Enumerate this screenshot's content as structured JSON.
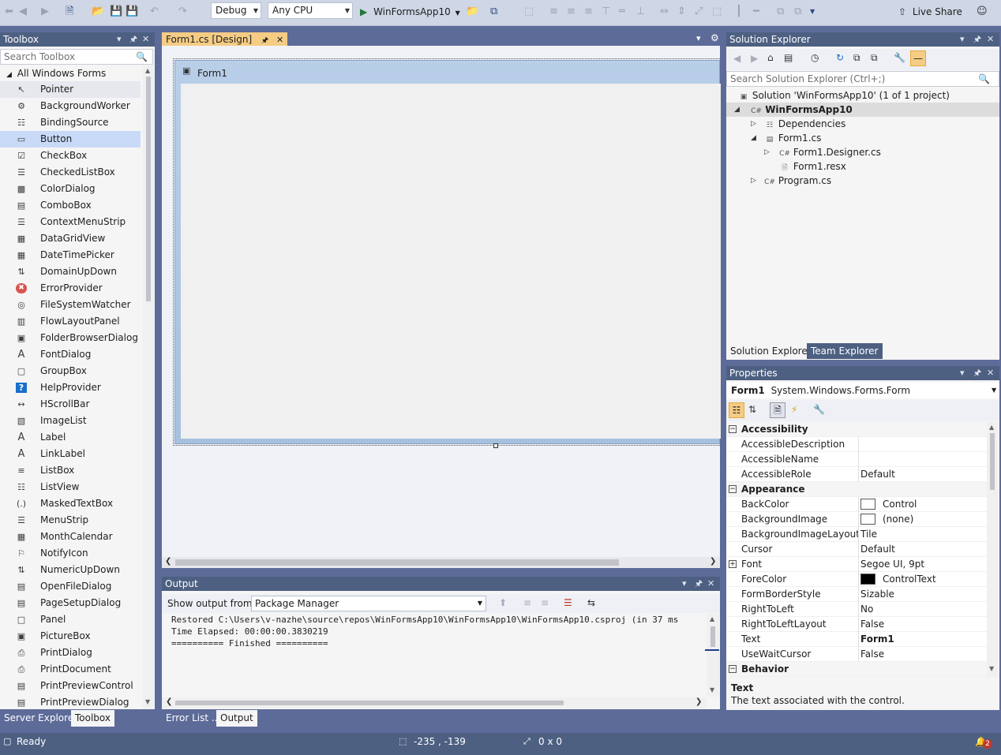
{
  "toolbar": {
    "config": "Debug",
    "platform": "Any CPU",
    "start_target": "WinFormsApp10",
    "live_share": "Live Share"
  },
  "toolbox": {
    "title": "Toolbox",
    "search_placeholder": "Search Toolbox",
    "group": "All Windows Forms",
    "items": [
      {
        "label": "Pointer",
        "icon": "pointer-icon"
      },
      {
        "label": "BackgroundWorker",
        "icon": "gear-icon"
      },
      {
        "label": "BindingSource",
        "icon": "binding-icon"
      },
      {
        "label": "Button",
        "icon": "button-icon"
      },
      {
        "label": "CheckBox",
        "icon": "checkbox-icon"
      },
      {
        "label": "CheckedListBox",
        "icon": "checklist-icon"
      },
      {
        "label": "ColorDialog",
        "icon": "color-icon"
      },
      {
        "label": "ComboBox",
        "icon": "combobox-icon"
      },
      {
        "label": "ContextMenuStrip",
        "icon": "menu-icon"
      },
      {
        "label": "DataGridView",
        "icon": "grid-icon"
      },
      {
        "label": "DateTimePicker",
        "icon": "calendar-icon"
      },
      {
        "label": "DomainUpDown",
        "icon": "updown-icon"
      },
      {
        "label": "ErrorProvider",
        "icon": "error-icon"
      },
      {
        "label": "FileSystemWatcher",
        "icon": "watcher-icon"
      },
      {
        "label": "FlowLayoutPanel",
        "icon": "flow-icon"
      },
      {
        "label": "FolderBrowserDialog",
        "icon": "folder-icon"
      },
      {
        "label": "FontDialog",
        "icon": "font-icon"
      },
      {
        "label": "GroupBox",
        "icon": "groupbox-icon"
      },
      {
        "label": "HelpProvider",
        "icon": "help-icon"
      },
      {
        "label": "HScrollBar",
        "icon": "hscroll-icon"
      },
      {
        "label": "ImageList",
        "icon": "imagelist-icon"
      },
      {
        "label": "Label",
        "icon": "label-icon"
      },
      {
        "label": "LinkLabel",
        "icon": "linklabel-icon"
      },
      {
        "label": "ListBox",
        "icon": "listbox-icon"
      },
      {
        "label": "ListView",
        "icon": "listview-icon"
      },
      {
        "label": "MaskedTextBox",
        "icon": "masked-icon"
      },
      {
        "label": "MenuStrip",
        "icon": "menustrip-icon"
      },
      {
        "label": "MonthCalendar",
        "icon": "month-icon"
      },
      {
        "label": "NotifyIcon",
        "icon": "notify-icon"
      },
      {
        "label": "NumericUpDown",
        "icon": "numeric-icon"
      },
      {
        "label": "OpenFileDialog",
        "icon": "openfile-icon"
      },
      {
        "label": "PageSetupDialog",
        "icon": "pagesetup-icon"
      },
      {
        "label": "Panel",
        "icon": "panel-icon"
      },
      {
        "label": "PictureBox",
        "icon": "picture-icon"
      },
      {
        "label": "PrintDialog",
        "icon": "print-icon"
      },
      {
        "label": "PrintDocument",
        "icon": "printdoc-icon"
      },
      {
        "label": "PrintPreviewControl",
        "icon": "preview-icon"
      },
      {
        "label": "PrintPreviewDialog",
        "icon": "previewdlg-icon"
      }
    ],
    "bottom_tabs": [
      "Server Explorer",
      "Toolbox"
    ]
  },
  "designer": {
    "tab_label": "Form1.cs [Design]",
    "form_title": "Form1"
  },
  "solution_explorer": {
    "title": "Solution Explorer",
    "search_placeholder": "Search Solution Explorer (Ctrl+;)",
    "nodes": [
      {
        "label": "Solution 'WinFormsApp10' (1 of 1 project)"
      },
      {
        "label": "WinFormsApp10"
      },
      {
        "label": "Dependencies"
      },
      {
        "label": "Form1.cs"
      },
      {
        "label": "Form1.Designer.cs"
      },
      {
        "label": "Form1.resx"
      },
      {
        "label": "Program.cs"
      }
    ],
    "tabs": [
      "Solution Explorer",
      "Team Explorer"
    ]
  },
  "properties": {
    "title": "Properties",
    "object_name": "Form1",
    "object_type": "System.Windows.Forms.Form",
    "rows": [
      {
        "kind": "cat",
        "name": "Accessibility"
      },
      {
        "kind": "prop",
        "name": "AccessibleDescription",
        "value": ""
      },
      {
        "kind": "prop",
        "name": "AccessibleName",
        "value": ""
      },
      {
        "kind": "prop",
        "name": "AccessibleRole",
        "value": "Default"
      },
      {
        "kind": "cat",
        "name": "Appearance"
      },
      {
        "kind": "prop",
        "name": "BackColor",
        "value": "Control",
        "swatch": "#ffffff"
      },
      {
        "kind": "prop",
        "name": "BackgroundImage",
        "value": "(none)",
        "swatch": "#ffffff"
      },
      {
        "kind": "prop",
        "name": "BackgroundImageLayout",
        "value": "Tile"
      },
      {
        "kind": "prop",
        "name": "Cursor",
        "value": "Default"
      },
      {
        "kind": "prop",
        "name": "Font",
        "value": "Segoe UI, 9pt",
        "expand": true
      },
      {
        "kind": "prop",
        "name": "ForeColor",
        "value": "ControlText",
        "swatch": "#000000"
      },
      {
        "kind": "prop",
        "name": "FormBorderStyle",
        "value": "Sizable"
      },
      {
        "kind": "prop",
        "name": "RightToLeft",
        "value": "No"
      },
      {
        "kind": "prop",
        "name": "RightToLeftLayout",
        "value": "False"
      },
      {
        "kind": "prop",
        "name": "Text",
        "value": "Form1",
        "bold": true
      },
      {
        "kind": "prop",
        "name": "UseWaitCursor",
        "value": "False"
      },
      {
        "kind": "cat",
        "name": "Behavior"
      }
    ],
    "desc_title": "Text",
    "desc_text": "The text associated with the control."
  },
  "output": {
    "title": "Output",
    "show_from_label": "Show output from:",
    "source": "Package Manager",
    "lines": [
      "Restored C:\\Users\\v-nazhe\\source\\repos\\WinFormsApp10\\WinFormsApp10\\WinFormsApp10.csproj (in 37 ms",
      "Time Elapsed: 00:00:00.3830219",
      "========== Finished =========="
    ],
    "bottom_tabs": [
      "Error List ...",
      "Output"
    ]
  },
  "status": {
    "text": "Ready",
    "position": "-235 , -139",
    "size": "0 x 0",
    "notifications": "2"
  }
}
